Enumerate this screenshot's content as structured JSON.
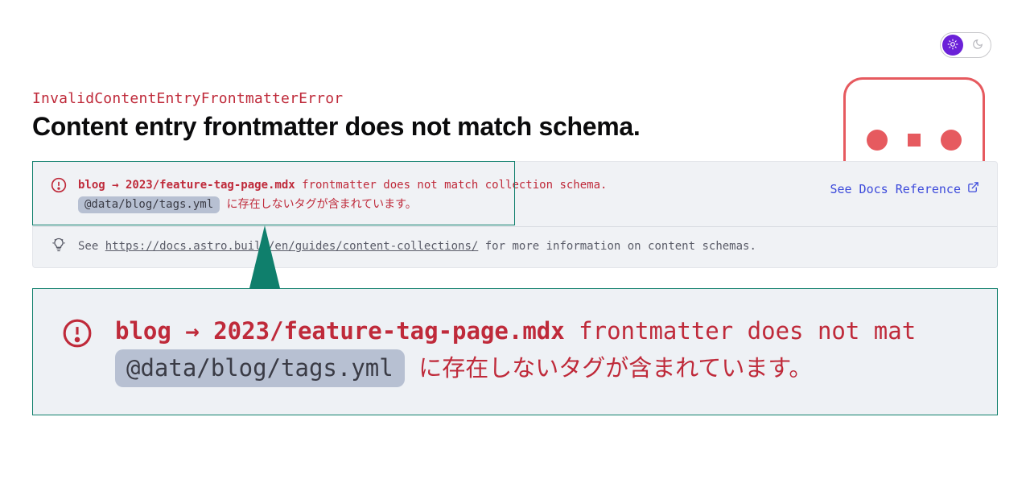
{
  "theme": {
    "sun_icon_name": "sun-icon",
    "moon_icon_name": "moon-icon",
    "active": "light",
    "accent": "#6b21d8"
  },
  "header": {
    "error_name": "InvalidContentEntryFrontmatterError",
    "error_title": "Content entry frontmatter does not match schema."
  },
  "panel": {
    "entry_path": "blog → 2023/feature-tag-page.mdx",
    "message_tail": " frontmatter does not match collection schema.",
    "file_chip": "@data/blog/tags.yml",
    "detail_tail": " に存在しないタグが含まれています。",
    "docs_link_label": "See Docs Reference",
    "hint_prefix": "See ",
    "hint_url": "https://docs.astro.build/en/guides/content-collections/",
    "hint_suffix": " for more information on content schemas."
  },
  "zoom": {
    "entry_path": "blog → 2023/feature-tag-page.mdx",
    "message_tail": " frontmatter does not mat",
    "file_chip": "@data/blog/tags.yml",
    "detail_tail": " に存在しないタグが含まれています。"
  },
  "colors": {
    "error_red": "#bf2a3a",
    "mascot_red": "#e65a5f",
    "teal": "#0f7f6c",
    "link_blue": "#3c4adb",
    "chip_bg": "#b7c0d2"
  },
  "icons": {
    "alert": "exclamation-circle-icon",
    "hint": "lightbulb-icon",
    "external": "external-link-icon"
  }
}
